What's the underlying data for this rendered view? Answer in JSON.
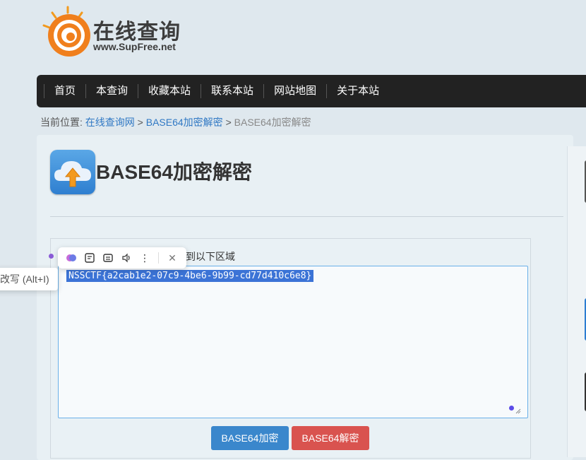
{
  "site": {
    "logo_title": "在线查询",
    "logo_domain": "www.SupFree.net"
  },
  "nav": {
    "items": [
      "首页",
      "本查询",
      "收藏本站",
      "联系本站",
      "网站地图",
      "关于本站"
    ]
  },
  "breadcrumb": {
    "prefix": "当前位置:",
    "link1": "在线查询网",
    "sep": ">",
    "link2": "BASE64加密解密",
    "current": "BASE64加密解密"
  },
  "page": {
    "title": "BASE64加密解密",
    "hint": "到以下区域",
    "textarea_value": "NSSCTF{a2cab1e2-07c9-4be6-9b99-cd77d410c6e8}",
    "encode_label": "BASE64加密",
    "decode_label": "BASE64解密"
  },
  "float_toolbar": {
    "icons": [
      "brain-icon",
      "note-icon",
      "scan-icon",
      "speaker-icon",
      "more-icon",
      "close-icon"
    ],
    "tooltip": "改写 (Alt+I)"
  },
  "colors": {
    "nav_bg": "#222222",
    "link": "#2f78c4",
    "encode_btn": "#3a87cc",
    "decode_btn": "#d9534f",
    "selection": "#3b73d6"
  }
}
